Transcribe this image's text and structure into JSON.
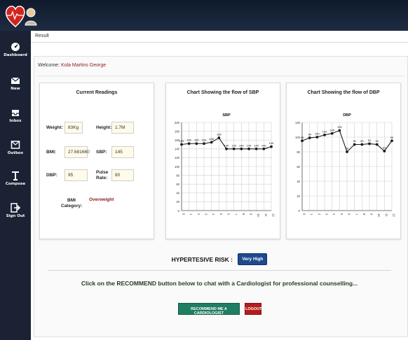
{
  "sidebar": {
    "items": [
      {
        "label": "Dashboard",
        "icon": "dashboard-icon"
      },
      {
        "label": "New",
        "icon": "envelope-icon"
      },
      {
        "label": "Inbox",
        "icon": "inbox-icon"
      },
      {
        "label": "Outbox",
        "icon": "outbox-icon"
      },
      {
        "label": "Compose",
        "icon": "compose-icon"
      },
      {
        "label": "Sign Out",
        "icon": "sign-out-icon"
      }
    ]
  },
  "breadcrumb": "Result",
  "welcome": {
    "prefix": "Welcome:",
    "name": "Kola Martins George"
  },
  "readings": {
    "title": "Current Readings",
    "weight_label": "Weight:",
    "weight_value": "83Kg",
    "height_label": "Height:",
    "height_value": "1.7M",
    "bmi_label": "BMI:",
    "bmi_value": "27.681660",
    "sbp_label": "SBP:",
    "sbp_value": "145",
    "dbp_label": "DBP:",
    "dbp_value": "95",
    "pulse_label_1": "Pulse",
    "pulse_label_2": "Rate:",
    "pulse_value": "80",
    "bmi_cat_label_1": "BMI",
    "bmi_cat_label_2": "Category:",
    "bmi_cat_value": "Overweight"
  },
  "chart_data": [
    {
      "type": "line",
      "panel_title": "Chart Showing the flow of SBP",
      "title": "SBP",
      "x": [
        "0",
        "1",
        "2",
        "3",
        "4",
        "5",
        "6",
        "7",
        "8",
        "9",
        "10",
        "11",
        "12"
      ],
      "values": [
        150,
        152,
        152,
        152,
        155,
        165,
        140,
        140,
        140,
        140,
        140,
        140,
        145
      ],
      "labels": [
        "150",
        "152",
        "152",
        "152",
        "155",
        "165",
        "140",
        "140",
        "140",
        "140",
        "140",
        "140",
        "145"
      ],
      "ylim": [
        0,
        200
      ],
      "yticks": [
        0,
        20,
        40,
        60,
        80,
        100,
        120,
        140,
        160,
        180,
        200
      ],
      "grid": true,
      "color": "#1a1a1a"
    },
    {
      "type": "line",
      "panel_title": "Chart Showing the flow of DBP",
      "title": "DBP",
      "x": [
        "0",
        "1",
        "2",
        "3",
        "4",
        "5",
        "6",
        "7",
        "8",
        "9",
        "10",
        "11",
        "12"
      ],
      "values": [
        95,
        99,
        100,
        103,
        105,
        109,
        80,
        90,
        90,
        91,
        90,
        81,
        95
      ],
      "labels": [
        "95",
        "99",
        "100",
        "103",
        "105",
        "109",
        "80",
        "90",
        "90",
        "91",
        "90",
        "81",
        "95"
      ],
      "ylim": [
        0,
        120
      ],
      "yticks": [
        0,
        20,
        40,
        60,
        80,
        100,
        120
      ],
      "grid": true,
      "color": "#1a1a1a"
    }
  ],
  "risk": {
    "label": "HYPERTESIVE RISK :",
    "value": "Very High",
    "badge_color": "#1d4a8f"
  },
  "advice": "Click on the RECOMMEND button below to chat with a Cardiologist for professional counselling...",
  "buttons": {
    "recommend": "RECOMMEND ME A CARDIOLOGIST",
    "logout": "LOGOUT"
  }
}
